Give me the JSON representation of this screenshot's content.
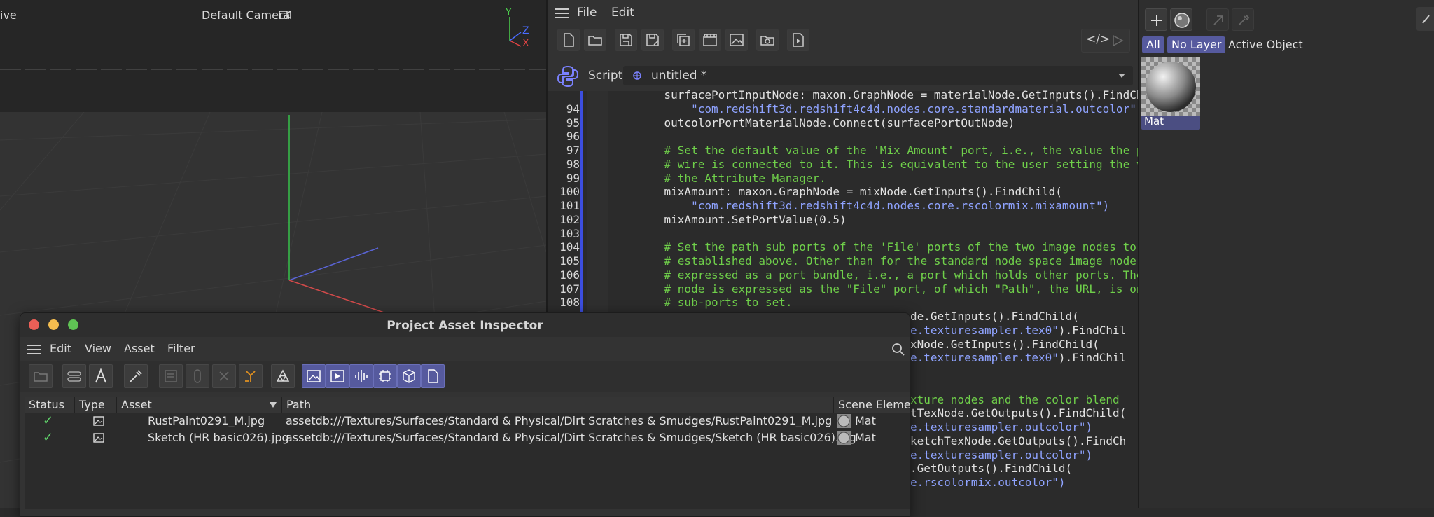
{
  "viewport": {
    "mode_label_partial": "ive",
    "camera_label": "Default Camera",
    "axes": {
      "y": "Y",
      "z": "Z",
      "x": "X"
    }
  },
  "script_manager": {
    "menu": [
      "File",
      "Edit"
    ],
    "script_label": "Script",
    "script_name": "untitled *",
    "code_lines": [
      {
        "n": "",
        "t": "    surfacePortInputNode: maxon.GraphNode = materialNode.GetInputs().FindChild(",
        "k": "code"
      },
      {
        "n": "94",
        "t": "        \"com.redshift3d.redshift4c4d.nodes.core.standardmaterial.outcolor\")",
        "k": "string"
      },
      {
        "n": "95",
        "t": "    outcolorPortMaterialNode.Connect(surfacePortOutNode)",
        "k": "code"
      },
      {
        "n": "96",
        "t": "",
        "k": "code"
      },
      {
        "n": "97",
        "t": "    # Set the default value of the 'Mix Amount' port, i.e., the value the port",
        "k": "comment"
      },
      {
        "n": "98",
        "t": "    # wire is connected to it. This is equivalent to the user setting the value",
        "k": "comment"
      },
      {
        "n": "99",
        "t": "    # the Attribute Manager.",
        "k": "comment"
      },
      {
        "n": "100",
        "t": "    mixAmount: maxon.GraphNode = mixNode.GetInputs().FindChild(",
        "k": "code"
      },
      {
        "n": "101",
        "t": "        \"com.redshift3d.redshift4c4d.nodes.core.rscolormix.mixamount\")",
        "k": "string"
      },
      {
        "n": "102",
        "t": "    mixAmount.SetPortValue(0.5)",
        "k": "code"
      },
      {
        "n": "103",
        "t": "",
        "k": "code"
      },
      {
        "n": "104",
        "t": "    # Set the path sub ports of the 'File' ports of the two image nodes to the",
        "k": "comment"
      },
      {
        "n": "105",
        "t": "    # established above. Other than for the standard node space image node, th",
        "k": "comment"
      },
      {
        "n": "106",
        "t": "    # expressed as a port bundle, i.e., a port which holds other ports. The te",
        "k": "comment"
      },
      {
        "n": "107",
        "t": "    # node is expressed as the \"File\" port, of which \"Path\", the URL, is only",
        "k": "comment"
      },
      {
        "n": "108",
        "t": "    # sub-ports to set.",
        "k": "comment"
      }
    ],
    "code_visible_right": [
      {
        "t": "de.GetInputs().FindChild(",
        "k": "code"
      },
      {
        "t": "e.texturesampler.tex0\").FindChil",
        "k": "mixed"
      },
      {
        "t": "xNode.GetInputs().FindChild(",
        "k": "code"
      },
      {
        "t": "e.texturesampler.tex0\").FindChil",
        "k": "mixed"
      },
      {
        "t": "",
        "k": "code"
      },
      {
        "t": "",
        "k": "code"
      },
      {
        "t": "xture nodes and the color blend",
        "k": "comment"
      },
      {
        "t": "tTexNode.GetOutputs().FindChild(",
        "k": "code"
      },
      {
        "t": "e.texturesampler.outcolor\")",
        "k": "string"
      },
      {
        "t": "ketchTexNode.GetOutputs().FindCh",
        "k": "code"
      },
      {
        "t": "e.texturesampler.outcolor\")",
        "k": "string"
      },
      {
        "t": ".GetOutputs().FindChild(",
        "k": "code"
      },
      {
        "t": "e.rscolormix.outcolor\")",
        "k": "string"
      }
    ]
  },
  "material_manager": {
    "filters": [
      "All",
      "No Layer",
      "Active Object"
    ],
    "material_name": "Mat"
  },
  "asset_inspector": {
    "title": "Project Asset Inspector",
    "menu": [
      "Edit",
      "View",
      "Asset",
      "Filter"
    ],
    "columns": [
      "Status",
      "Type",
      "Asset",
      "Path",
      "Scene Elemen"
    ],
    "rows": [
      {
        "status": "✓",
        "asset": "RustPaint0291_M.jpg",
        "path": "assetdb:///Textures/Surfaces/Standard & Physical/Dirt Scratches & Smudges/RustPaint0291_M.jpg",
        "scene": "Mat"
      },
      {
        "status": "✓",
        "asset": "Sketch (HR basic026).jpg",
        "path": "assetdb:///Textures/Surfaces/Standard & Physical/Dirt Scratches & Smudges/Sketch (HR basic026).jpg",
        "scene": "Mat"
      }
    ]
  },
  "colors": {
    "accent_blue": "#3c4ee0",
    "comment_green": "#6fcf4a",
    "string_blue": "#8fa3ff",
    "selected_filter": "#565a9e",
    "check_green": "#5fd16a"
  }
}
